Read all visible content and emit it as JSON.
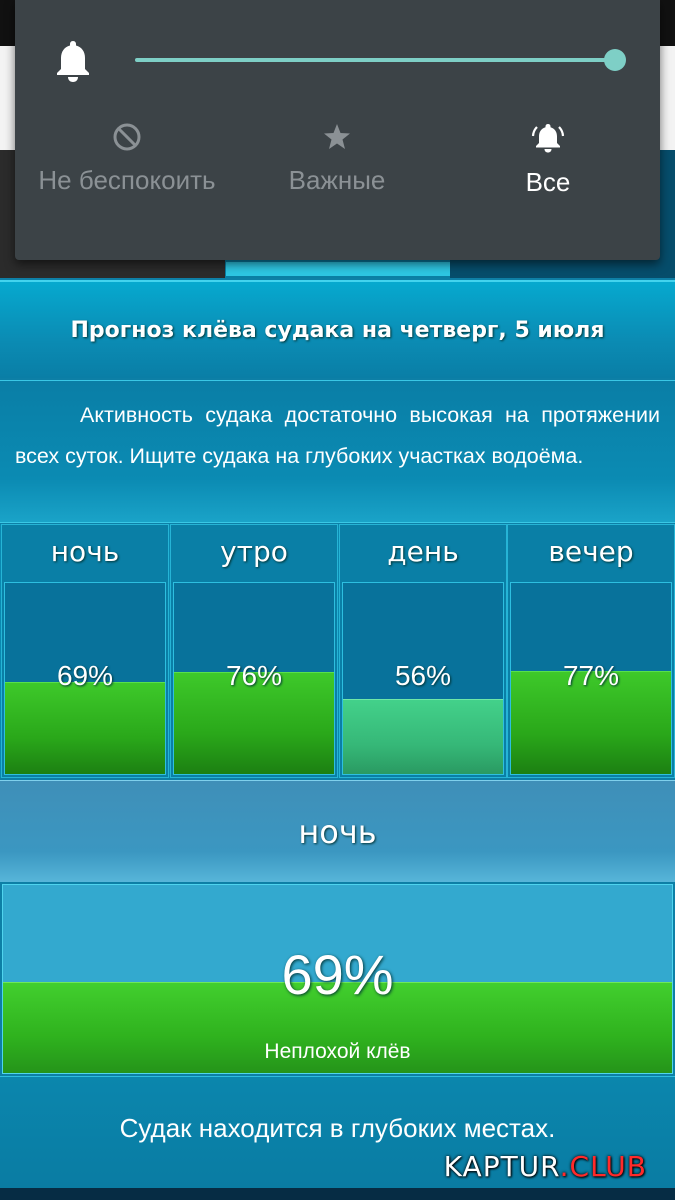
{
  "volume_panel": {
    "level": 1.0,
    "accent_color": "#7ecfc6",
    "modes": [
      {
        "label": "Не беспокоить",
        "icon": "do-not-disturb-icon",
        "active": false
      },
      {
        "label": "Важные",
        "icon": "star-icon",
        "active": false
      },
      {
        "label": "Все",
        "icon": "bell-ringing-icon",
        "active": true
      }
    ]
  },
  "forecast": {
    "title": "Прогноз клёва судака на четверг, 5 июля",
    "description": "Активность судака достаточно высокая на протяжении всех суток. Ищите судака на глубоких участках водоёма.",
    "periods": [
      {
        "label": "ночь",
        "percent_text": "69%",
        "value": 69
      },
      {
        "label": "утро",
        "percent_text": "76%",
        "value": 76
      },
      {
        "label": "день",
        "percent_text": "56%",
        "value": 56
      },
      {
        "label": "вечер",
        "percent_text": "77%",
        "value": 77
      }
    ],
    "selected": {
      "label": "ночь",
      "percent_text": "69%",
      "value": 69,
      "quality": "Неплохой клёв"
    },
    "location_tip": "Судак находится в глубоких местах."
  },
  "watermark": {
    "part1": "KAPTUR",
    "part2": ".CLUB"
  },
  "colors": {
    "bar_green": "#2aa81a",
    "bar_soft_green": "#36b878",
    "background_blue": "#0a7fa6"
  }
}
